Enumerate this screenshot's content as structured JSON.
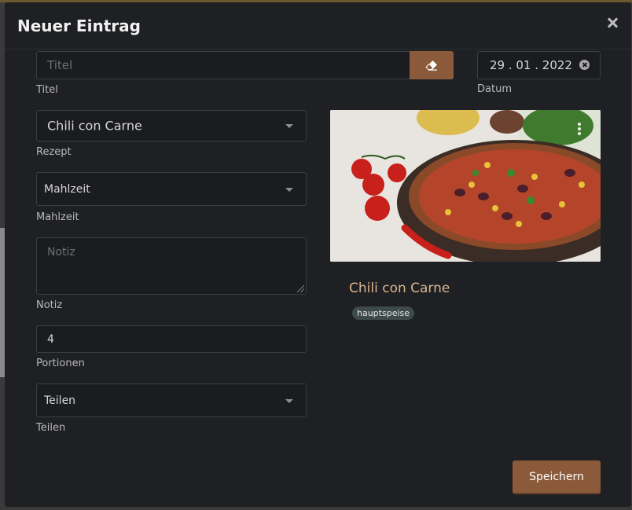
{
  "dialog": {
    "title": "Neuer Eintrag",
    "close_icon": "close-icon"
  },
  "form": {
    "title_field": {
      "placeholder": "Titel",
      "value": "",
      "label": "Titel",
      "action_icon": "eraser-icon"
    },
    "date_field": {
      "value": "29 . 01 . 2022",
      "label": "Datum",
      "clear_icon": "clear-circle-icon"
    },
    "recipe_select": {
      "value": "Chili con Carne",
      "label": "Rezept"
    },
    "meal_select": {
      "value": "Mahlzeit",
      "label": "Mahlzeit"
    },
    "note_field": {
      "placeholder": "Notiz",
      "value": "",
      "label": "Notiz"
    },
    "servings_field": {
      "value": "4",
      "label": "Portionen"
    },
    "share_select": {
      "value": "Teilen",
      "label": "Teilen"
    }
  },
  "recipe_card": {
    "name": "Chili con Carne",
    "tag": "hauptspeise",
    "menu_icon": "kebab-menu-icon"
  },
  "footer": {
    "save_label": "Speichern"
  },
  "colors": {
    "modal_bg": "#1f2023",
    "accent": "#8b5a3b",
    "recipe_title": "#d9b48f",
    "tag_bg": "#3d4a48"
  }
}
